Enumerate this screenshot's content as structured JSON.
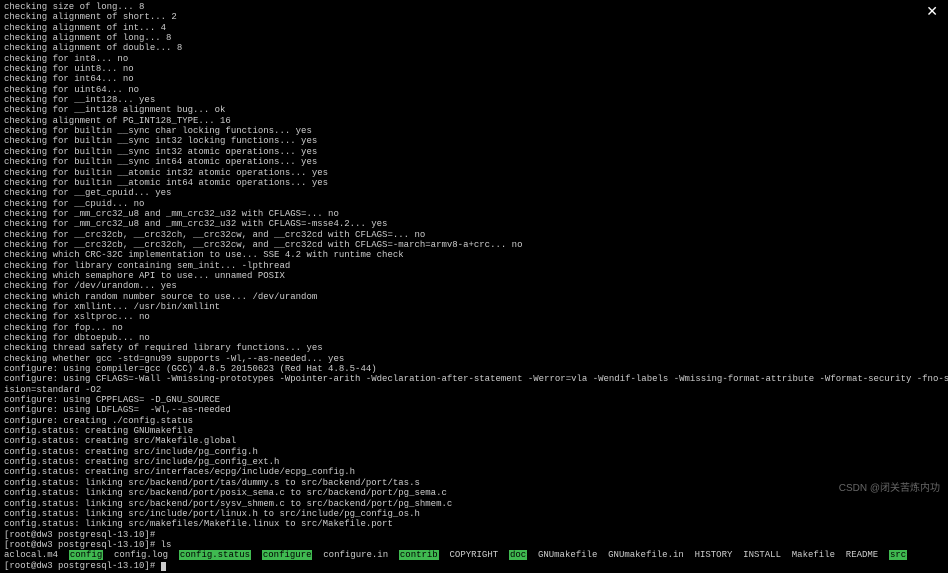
{
  "close_label": "✕",
  "watermark": "CSDN @闭关苦炼内功",
  "lines": [
    {
      "t": "checking size of long... 8"
    },
    {
      "t": "checking alignment of short... 2"
    },
    {
      "t": "checking alignment of int... 4"
    },
    {
      "t": "checking alignment of long... 8"
    },
    {
      "t": "checking alignment of double... 8"
    },
    {
      "t": "checking for int8... no"
    },
    {
      "t": "checking for uint8... no"
    },
    {
      "t": "checking for int64... no"
    },
    {
      "t": "checking for uint64... no"
    },
    {
      "t": "checking for __int128... yes"
    },
    {
      "t": "checking for __int128 alignment bug... ok"
    },
    {
      "t": "checking alignment of PG_INT128_TYPE... 16"
    },
    {
      "t": "checking for builtin __sync char locking functions... yes"
    },
    {
      "t": "checking for builtin __sync int32 locking functions... yes"
    },
    {
      "t": "checking for builtin __sync int32 atomic operations... yes"
    },
    {
      "t": "checking for builtin __sync int64 atomic operations... yes"
    },
    {
      "t": "checking for builtin __atomic int32 atomic operations... yes"
    },
    {
      "t": "checking for builtin __atomic int64 atomic operations... yes"
    },
    {
      "t": "checking for __get_cpuid... yes"
    },
    {
      "t": "checking for __cpuid... no"
    },
    {
      "t": "checking for _mm_crc32_u8 and _mm_crc32_u32 with CFLAGS=... no"
    },
    {
      "t": "checking for _mm_crc32_u8 and _mm_crc32_u32 with CFLAGS=-msse4.2... yes"
    },
    {
      "t": "checking for __crc32cb, __crc32ch, __crc32cw, and __crc32cd with CFLAGS=... no"
    },
    {
      "t": "checking for __crc32cb, __crc32ch, __crc32cw, and __crc32cd with CFLAGS=-march=armv8-a+crc... no"
    },
    {
      "t": "checking which CRC-32C implementation to use... SSE 4.2 with runtime check"
    },
    {
      "t": "checking for library containing sem_init... -lpthread"
    },
    {
      "t": "checking which semaphore API to use... unnamed POSIX"
    },
    {
      "t": "checking for /dev/urandom... yes"
    },
    {
      "t": "checking which random number source to use... /dev/urandom"
    },
    {
      "t": "checking for xmllint... /usr/bin/xmllint"
    },
    {
      "t": "checking for xsltproc... no"
    },
    {
      "t": "checking for fop... no"
    },
    {
      "t": "checking for dbtoepub... no"
    },
    {
      "t": "checking thread safety of required library functions... yes"
    },
    {
      "t": "checking whether gcc -std=gnu99 supports -Wl,--as-needed... yes"
    },
    {
      "t": "configure: using compiler=gcc (GCC) 4.8.5 20150623 (Red Hat 4.8.5-44)"
    },
    {
      "t": "configure: using CFLAGS=-Wall -Wmissing-prototypes -Wpointer-arith -Wdeclaration-after-statement -Werror=vla -Wendif-labels -Wmissing-format-attribute -Wformat-security -fno-strict-aliasing -fwrapv -fexcess-prec"
    },
    {
      "t": "ision=standard -O2"
    },
    {
      "t": "configure: using CPPFLAGS= -D_GNU_SOURCE"
    },
    {
      "t": "configure: using LDFLAGS=  -Wl,--as-needed"
    },
    {
      "t": "configure: creating ./config.status"
    },
    {
      "t": "config.status: creating GNUmakefile"
    },
    {
      "t": "config.status: creating src/Makefile.global"
    },
    {
      "t": "config.status: creating src/include/pg_config.h"
    },
    {
      "t": "config.status: creating src/include/pg_config_ext.h"
    },
    {
      "t": "config.status: creating src/interfaces/ecpg/include/ecpg_config.h"
    },
    {
      "t": "config.status: linking src/backend/port/tas/dummy.s to src/backend/port/tas.s"
    },
    {
      "t": "config.status: linking src/backend/port/posix_sema.c to src/backend/port/pg_sema.c"
    },
    {
      "t": "config.status: linking src/backend/port/sysv_shmem.c to src/backend/port/pg_shmem.c"
    },
    {
      "t": "config.status: linking src/include/port/linux.h to src/include/pg_config_os.h"
    },
    {
      "t": "config.status: linking src/makefiles/Makefile.linux to src/Makefile.port"
    },
    {
      "t": "[root@dw3 postgresql-13.10]#"
    },
    {
      "t": "[root@dw3 postgresql-13.10]# ls"
    }
  ],
  "ls_output": [
    {
      "t": "aclocal.m4  ",
      "hl": false
    },
    {
      "t": "config",
      "hl": true
    },
    {
      "t": "  config.log  ",
      "hl": false
    },
    {
      "t": "config.status",
      "hl": true
    },
    {
      "t": "  ",
      "hl": false
    },
    {
      "t": "configure",
      "hl": true
    },
    {
      "t": "  configure.in  ",
      "hl": false
    },
    {
      "t": "contrib",
      "hl": true
    },
    {
      "t": "  COPYRIGHT  ",
      "hl": false
    },
    {
      "t": "doc",
      "hl": true
    },
    {
      "t": "  GNUmakefile  GNUmakefile.in  HISTORY  INSTALL  Makefile  README  ",
      "hl": false
    },
    {
      "t": "src",
      "hl": true
    }
  ],
  "prompt_final": "[root@dw3 postgresql-13.10]# "
}
